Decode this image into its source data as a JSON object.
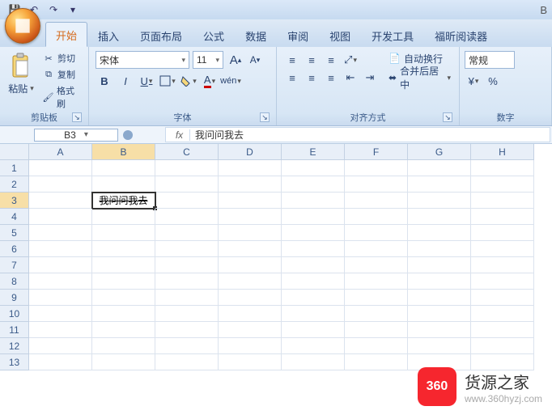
{
  "qat": {
    "save": "💾",
    "undo": "↶",
    "redo": "↷"
  },
  "tabs": [
    "开始",
    "插入",
    "页面布局",
    "公式",
    "数据",
    "审阅",
    "视图",
    "开发工具",
    "福昕阅读器"
  ],
  "active_tab_index": 0,
  "title_right": "B",
  "clipboard": {
    "paste": "粘贴",
    "cut": "剪切",
    "copy": "复制",
    "format_painter": "格式刷",
    "group": "剪贴板"
  },
  "font": {
    "name": "宋体",
    "size": "11",
    "group": "字体",
    "bold": "B",
    "italic": "I",
    "underline": "U"
  },
  "alignment": {
    "wrap": "自动换行",
    "merge": "合并后居中",
    "group": "对齐方式"
  },
  "number": {
    "format": "常规",
    "group": "数字"
  },
  "namebox": "B3",
  "fx_label": "fx",
  "formula_value": "我问问我去",
  "columns": [
    "A",
    "B",
    "C",
    "D",
    "E",
    "F",
    "G",
    "H"
  ],
  "rows": 13,
  "selected": {
    "row": 3,
    "col": 1
  },
  "cell_B3": "我问问我去",
  "watermark": {
    "badge": "360",
    "title": "货源之家",
    "url": "www.360hyzj.com"
  }
}
